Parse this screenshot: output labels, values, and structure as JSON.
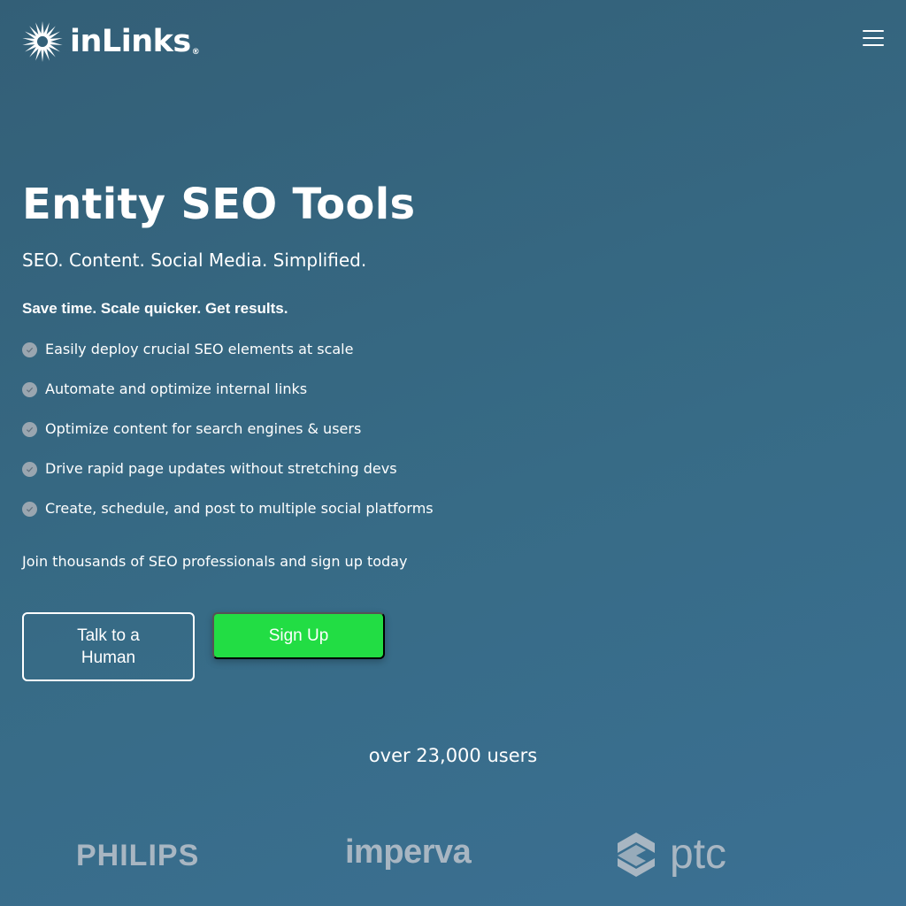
{
  "header": {
    "logo_text": "inLinks",
    "logo_reg": "®",
    "menu_icon": "hamburger-menu-icon"
  },
  "hero": {
    "title": "Entity SEO Tools",
    "subtitle": "SEO. Content. Social Media. Simplified.",
    "tagline": "Save time. Scale quicker. Get results.",
    "features": [
      "Easily deploy crucial SEO elements at scale",
      "Automate and optimize internal links",
      "Optimize content for search engines & users",
      "Drive rapid page updates without stretching devs",
      "Create, schedule, and post to multiple social platforms"
    ],
    "feature_icon": "check-circle-icon",
    "join_text": "Join thousands of SEO professionals and sign up today"
  },
  "buttons": {
    "talk_label": "Talk to a Human",
    "signup_label": "Sign Up"
  },
  "social_proof": {
    "users_text": "over 23,000 users",
    "clients": [
      "PHILIPS",
      "imperva",
      "ptc"
    ]
  },
  "colors": {
    "background_start": "#335f77",
    "background_end": "#3b7093",
    "signup_button": "#22dd44",
    "check_icon": "#9aa6b0",
    "client_logo": "#a8b6c2"
  }
}
